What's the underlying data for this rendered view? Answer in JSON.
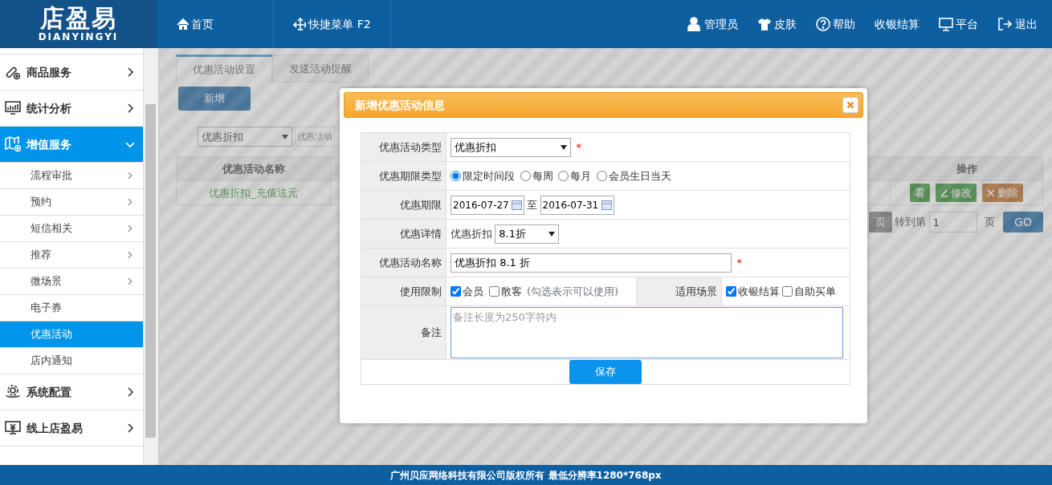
{
  "header": {
    "logo_title": "店盈易",
    "logo_subtitle": "DIANYINGYI",
    "nav_left": [
      {
        "label": "首页"
      },
      {
        "label": "快捷菜单 F2"
      }
    ],
    "nav_right": [
      {
        "label": "管理员"
      },
      {
        "label": "皮肤"
      },
      {
        "label": "帮助"
      },
      {
        "label": "收银结算"
      },
      {
        "label": "平台"
      },
      {
        "label": "退出"
      }
    ]
  },
  "sidebar": {
    "items": [
      {
        "label": "商品服务",
        "expanded": false,
        "selected": false
      },
      {
        "label": "统计分析",
        "expanded": false,
        "selected": false
      },
      {
        "label": "增值服务",
        "expanded": true,
        "selected": true,
        "children": [
          {
            "label": "流程审批",
            "has_submenu": true,
            "selected": false
          },
          {
            "label": "预约",
            "has_submenu": true,
            "selected": false
          },
          {
            "label": "短信相关",
            "has_submenu": true,
            "selected": false
          },
          {
            "label": "推荐",
            "has_submenu": true,
            "selected": false
          },
          {
            "label": "微场景",
            "has_submenu": true,
            "selected": false
          },
          {
            "label": "电子券",
            "has_submenu": false,
            "selected": false
          },
          {
            "label": "优惠活动",
            "has_submenu": false,
            "selected": true
          },
          {
            "label": "店内通知",
            "has_submenu": false,
            "selected": false
          }
        ]
      },
      {
        "label": "系统配置",
        "expanded": false,
        "selected": false
      },
      {
        "label": "线上店盈易",
        "expanded": false,
        "selected": false
      }
    ]
  },
  "page": {
    "tabs": [
      {
        "label": "优惠活动设置",
        "selected": true
      },
      {
        "label": "发送活动提醒",
        "selected": false
      }
    ],
    "add_button": "新增",
    "filter": {
      "value": "优惠折扣",
      "placeholder": "优惠活动"
    },
    "table": {
      "columns": [
        "优惠活动名称",
        "操作"
      ],
      "rows": [
        {
          "name": "优惠折扣_充值送元",
          "actions": [
            {
              "label": "看",
              "kind": "view"
            },
            {
              "label": "修改",
              "kind": "edit"
            },
            {
              "label": "删除",
              "kind": "delete"
            }
          ]
        }
      ]
    },
    "pager": {
      "last": "页",
      "goto_label": "转到第",
      "page_value": "1",
      "page_suffix": "页",
      "go": "GO"
    }
  },
  "modal": {
    "title": "新增优惠活动信息",
    "type": {
      "label": "优惠活动类型",
      "value": "优惠折扣",
      "required_mark": "*"
    },
    "period_type": {
      "label": "优惠期限类型",
      "options": [
        {
          "label": "限定时间段",
          "selected": true
        },
        {
          "label": "每周",
          "selected": false
        },
        {
          "label": "每月",
          "selected": false
        },
        {
          "label": "会员生日当天",
          "selected": false
        }
      ]
    },
    "period": {
      "label": "优惠期限",
      "start": "2016-07-27",
      "separator": "至",
      "end": "2016-07-31"
    },
    "detail": {
      "label": "优惠详情",
      "prefix": "优惠折扣",
      "value": "8.1折"
    },
    "name": {
      "label": "优惠活动名称",
      "value": "优惠折扣 8.1 折",
      "required_mark": "*"
    },
    "usage": {
      "label": "使用限制",
      "options": [
        {
          "label": "会员",
          "checked": true
        },
        {
          "label": "散客",
          "checked": false
        }
      ],
      "hint": "(勾选表示可以使用)"
    },
    "scene": {
      "label": "适用场景",
      "options": [
        {
          "label": "收银结算",
          "checked": true
        },
        {
          "label": "自助买单",
          "checked": false
        }
      ]
    },
    "note": {
      "label": "备注",
      "placeholder": "备注长度为250字符内"
    },
    "save": "保存"
  },
  "footer": "广州贝应网络科技有限公司版权所有 最低分辨率1280*768px"
}
